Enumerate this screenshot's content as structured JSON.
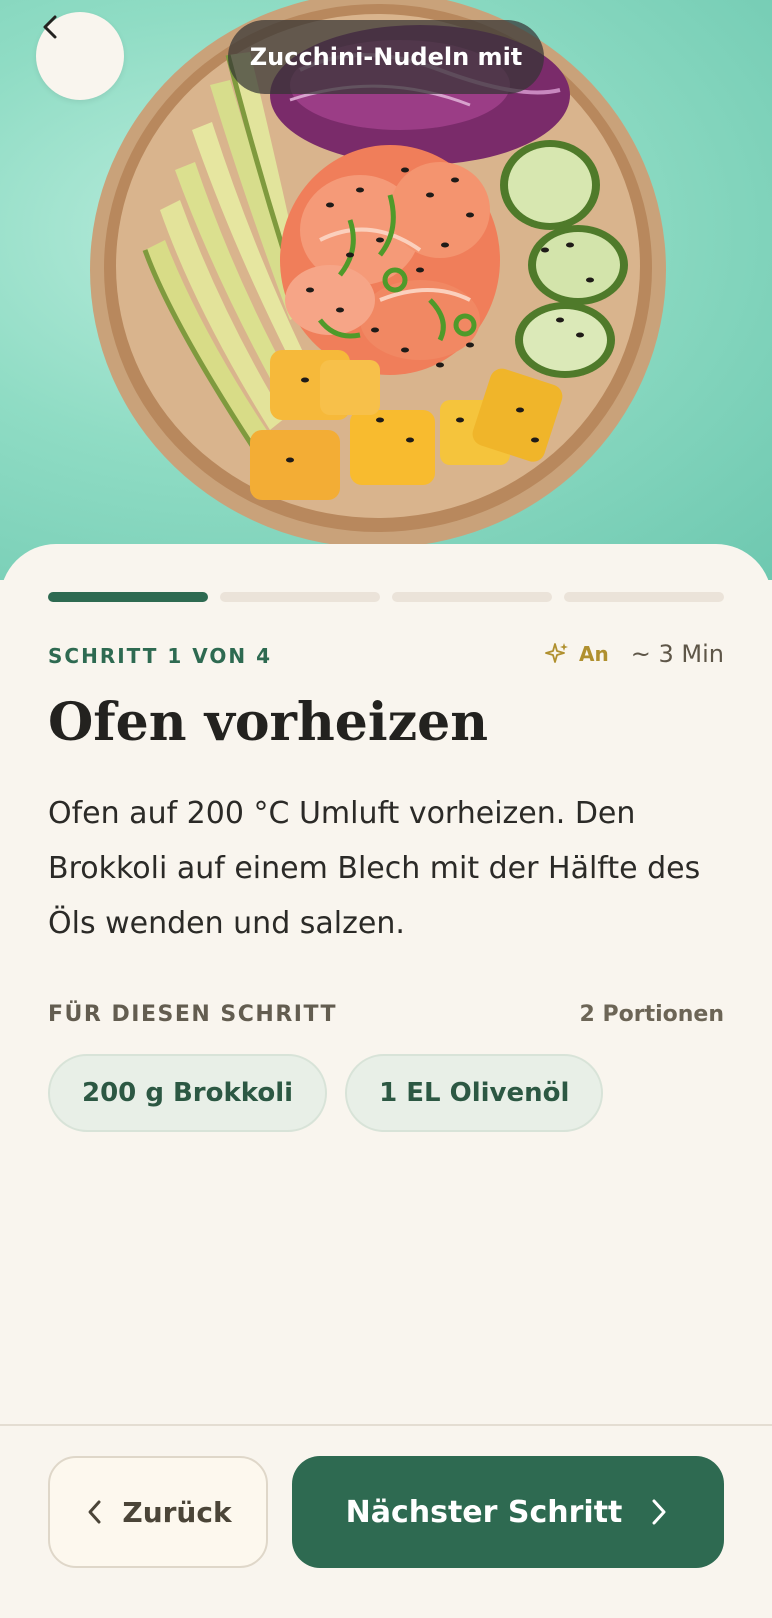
{
  "header": {
    "recipe_title": "Zucchini-Nudeln mit"
  },
  "step": {
    "label": "SCHRITT 1 VON 4",
    "current": 1,
    "total": 4,
    "ai_label": "An",
    "time": "~ 3 Min",
    "title": "Ofen vorheizen",
    "text": "Ofen auf 200 °C Umluft vorheizen. Den Brokkoli auf einem Blech mit der Hälfte des Öls wenden und salzen."
  },
  "ingredients": {
    "section_label": "FÜR DIESEN SCHRITT",
    "portions": "2 Portionen",
    "items": [
      "200 g Brokkoli",
      "1 EL Olivenöl"
    ]
  },
  "footer": {
    "back_label": "Zurück",
    "next_label": "Nächster Schritt"
  },
  "icons": {
    "back": "chevron-left-icon",
    "sparkle": "sparkle-icon",
    "next": "chevron-right-icon"
  },
  "colors": {
    "accent": "#2e6a51",
    "ai": "#b0902f",
    "background": "#f9f5ee",
    "progress_inactive": "#ebe3d9",
    "chip_bg": "#e8efe7"
  }
}
